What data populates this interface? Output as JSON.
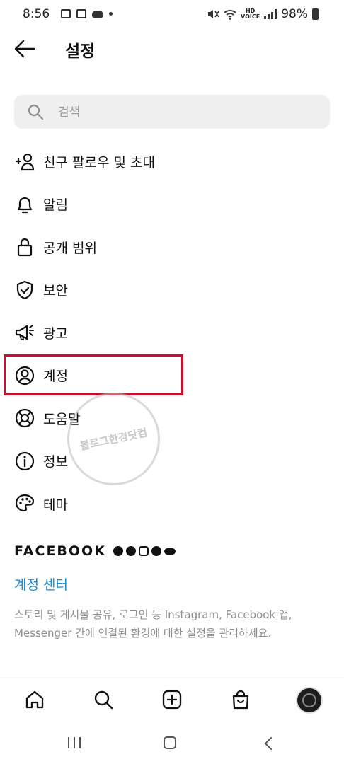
{
  "status_bar": {
    "time": "8:56",
    "battery": "98%",
    "network_label": "HD"
  },
  "header": {
    "title": "설정"
  },
  "search": {
    "placeholder": "검색"
  },
  "menu": {
    "items": [
      {
        "label": "친구 팔로우 및 초대",
        "icon": "add-person-icon"
      },
      {
        "label": "알림",
        "icon": "bell-icon"
      },
      {
        "label": "공개 범위",
        "icon": "lock-icon"
      },
      {
        "label": "보안",
        "icon": "shield-icon"
      },
      {
        "label": "광고",
        "icon": "megaphone-icon"
      },
      {
        "label": "계정",
        "icon": "account-circle-icon"
      },
      {
        "label": "도움말",
        "icon": "lifebuoy-icon"
      },
      {
        "label": "정보",
        "icon": "info-icon"
      },
      {
        "label": "테마",
        "icon": "palette-icon"
      }
    ],
    "highlighted_index": 5
  },
  "facebook": {
    "heading": "FACEBOOK",
    "accounts_center": "계정 센터",
    "description": "스토리 및 게시물 공유, 로그인 등 Instagram, Facebook 앱, Messenger 간에 연결된 환경에 대한 설정을 관리하세요."
  },
  "watermark": {
    "text": "블로그한경닷컴"
  },
  "colors": {
    "highlight": "#c8102e",
    "link": "#1a8cd8",
    "search_bg": "#efefef"
  }
}
